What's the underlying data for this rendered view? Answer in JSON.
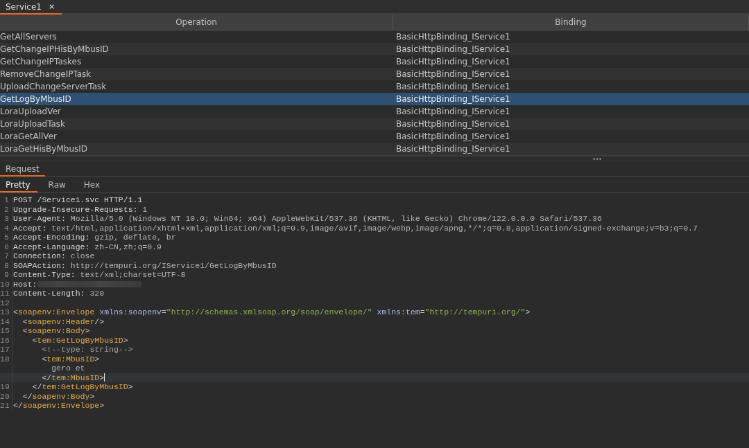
{
  "editor_tabs": [
    {
      "label": "Service1",
      "selected": true,
      "close": "×"
    }
  ],
  "operations": {
    "columns": [
      "Operation",
      "Binding"
    ],
    "rows": [
      {
        "operation": "GetAllServers",
        "binding": "BasicHttpBinding_IService1",
        "selected": false
      },
      {
        "operation": "GetChangeIPHisByMbusID",
        "binding": "BasicHttpBinding_IService1",
        "selected": false
      },
      {
        "operation": "GetChangeIPTaskes",
        "binding": "BasicHttpBinding_IService1",
        "selected": false
      },
      {
        "operation": "RemoveChangeIPTask",
        "binding": "BasicHttpBinding_IService1",
        "selected": false
      },
      {
        "operation": "UploadChangeServerTask",
        "binding": "BasicHttpBinding_IService1",
        "selected": false
      },
      {
        "operation": "GetLogByMbusID",
        "binding": "BasicHttpBinding_IService1",
        "selected": true
      },
      {
        "operation": "LoraUploadVer",
        "binding": "BasicHttpBinding_IService1",
        "selected": false
      },
      {
        "operation": "LoraUploadTask",
        "binding": "BasicHttpBinding_IService1",
        "selected": false
      },
      {
        "operation": "LoraGetAllVer",
        "binding": "BasicHttpBinding_IService1",
        "selected": false
      },
      {
        "operation": "LoraGetHisByMbusID",
        "binding": "BasicHttpBinding_IService1",
        "selected": false
      }
    ]
  },
  "request": {
    "title": "Request",
    "view_tabs": [
      {
        "label": "Pretty",
        "selected": true
      },
      {
        "label": "Raw",
        "selected": false
      },
      {
        "label": "Hex",
        "selected": false
      }
    ],
    "lines": [
      {
        "number": "1",
        "current": false,
        "tokens": [
          {
            "kind": "key",
            "text": "POST /Service1.svc HTTP/1.1"
          }
        ]
      },
      {
        "number": "2",
        "current": false,
        "tokens": [
          {
            "kind": "key",
            "text": "Upgrade-Insecure-Requests:"
          },
          {
            "kind": "value",
            "text": " 1"
          }
        ]
      },
      {
        "number": "3",
        "current": false,
        "tokens": [
          {
            "kind": "key",
            "text": "User-Agent:"
          },
          {
            "kind": "value",
            "text": " Mozilla/5.0 (Windows NT 10.0; Win64; x64) AppleWebKit/537.36 (KHTML, like Gecko) Chrome/122.0.0.0 Safari/537.36"
          }
        ]
      },
      {
        "number": "4",
        "current": false,
        "tokens": [
          {
            "kind": "key",
            "text": "Accept:"
          },
          {
            "kind": "value",
            "text": " text/html,application/xhtml+xml,application/xml;q=0.9,image/avif,image/webp,image/apng,*/*;q=0.8,application/signed-exchange;v=b3;q=0.7"
          }
        ]
      },
      {
        "number": "5",
        "current": false,
        "tokens": [
          {
            "kind": "key",
            "text": "Accept-Encoding:"
          },
          {
            "kind": "value",
            "text": " gzip, deflate, br"
          }
        ]
      },
      {
        "number": "6",
        "current": false,
        "tokens": [
          {
            "kind": "key",
            "text": "Accept-Language:"
          },
          {
            "kind": "value",
            "text": " zh-CN,zh;q=0.9"
          }
        ]
      },
      {
        "number": "7",
        "current": false,
        "tokens": [
          {
            "kind": "key",
            "text": "Connection:"
          },
          {
            "kind": "value",
            "text": " close"
          }
        ]
      },
      {
        "number": "8",
        "current": false,
        "tokens": [
          {
            "kind": "key",
            "text": "SOAPAction:"
          },
          {
            "kind": "value",
            "text": " http://tempuri.org/IService1/GetLogByMbusID"
          }
        ]
      },
      {
        "number": "9",
        "current": false,
        "tokens": [
          {
            "kind": "key",
            "text": "Content-Type:"
          },
          {
            "kind": "value",
            "text": " text/xml;charset=UTF-8"
          }
        ]
      },
      {
        "number": "10",
        "current": false,
        "tokens": [
          {
            "kind": "key",
            "text": "Host:"
          },
          {
            "kind": "redacted"
          }
        ]
      },
      {
        "number": "11",
        "current": false,
        "tokens": [
          {
            "kind": "key",
            "text": "Content-Length:"
          },
          {
            "kind": "value",
            "text": " 320"
          }
        ]
      },
      {
        "number": "12",
        "current": false
      },
      {
        "number": "13",
        "current": false,
        "tokens": [
          {
            "kind": "punct",
            "text": "<"
          },
          {
            "kind": "tag",
            "text": "soapenv:Envelope"
          },
          {
            "kind": "attr",
            "text": " xmlns:soapenv"
          },
          {
            "kind": "punct",
            "text": "="
          },
          {
            "kind": "string",
            "text": "\"http://schemas.xmlsoap.org/soap/envelope/\""
          },
          {
            "kind": "attr",
            "text": " xmlns:tem"
          },
          {
            "kind": "punct",
            "text": "="
          },
          {
            "kind": "string",
            "text": "\"http://tempuri.org/\""
          },
          {
            "kind": "punct",
            "text": ">"
          }
        ]
      },
      {
        "number": "14",
        "current": false,
        "tokens": [
          {
            "kind": "punct",
            "text": "  <"
          },
          {
            "kind": "tag",
            "text": "soapenv:Header"
          },
          {
            "kind": "punct",
            "text": "/>"
          }
        ]
      },
      {
        "number": "15",
        "current": false,
        "tokens": [
          {
            "kind": "punct",
            "text": "  <"
          },
          {
            "kind": "tag",
            "text": "soapenv:Body"
          },
          {
            "kind": "punct",
            "text": ">"
          }
        ]
      },
      {
        "number": "16",
        "current": false,
        "tokens": [
          {
            "kind": "punct",
            "text": "    <"
          },
          {
            "kind": "tag",
            "text": "tem:GetLogByMbusID"
          },
          {
            "kind": "punct",
            "text": ">"
          }
        ]
      },
      {
        "number": "17",
        "current": false,
        "tokens": [
          {
            "kind": "comment",
            "text": "      <!--type: string-->"
          }
        ]
      },
      {
        "number": "18",
        "current": false,
        "tokens": [
          {
            "kind": "punct",
            "text": "      <"
          },
          {
            "kind": "tag",
            "text": "tem:MbusID"
          },
          {
            "kind": "punct",
            "text": ">"
          }
        ]
      },
      {
        "current": false,
        "tokens": [
          {
            "kind": "value",
            "text": "        gero et"
          }
        ]
      },
      {
        "current": true,
        "tokens": [
          {
            "kind": "punct",
            "text": "      </"
          },
          {
            "kind": "tag",
            "text": "tem:MbusID"
          },
          {
            "kind": "punct",
            "text": ">"
          }
        ]
      },
      {
        "number": "19",
        "current": false,
        "tokens": [
          {
            "kind": "punct",
            "text": "    </"
          },
          {
            "kind": "tag",
            "text": "tem:GetLogByMbusID"
          },
          {
            "kind": "punct",
            "text": ">"
          }
        ]
      },
      {
        "number": "20",
        "current": false,
        "tokens": [
          {
            "kind": "punct",
            "text": "  </"
          },
          {
            "kind": "tag",
            "text": "soapenv:Body"
          },
          {
            "kind": "punct",
            "text": ">"
          }
        ]
      },
      {
        "number": "21",
        "current": false,
        "tokens": [
          {
            "kind": "punct",
            "text": "</"
          },
          {
            "kind": "tag",
            "text": "soapenv:Envelope"
          },
          {
            "kind": "punct",
            "text": ">"
          }
        ]
      }
    ]
  }
}
